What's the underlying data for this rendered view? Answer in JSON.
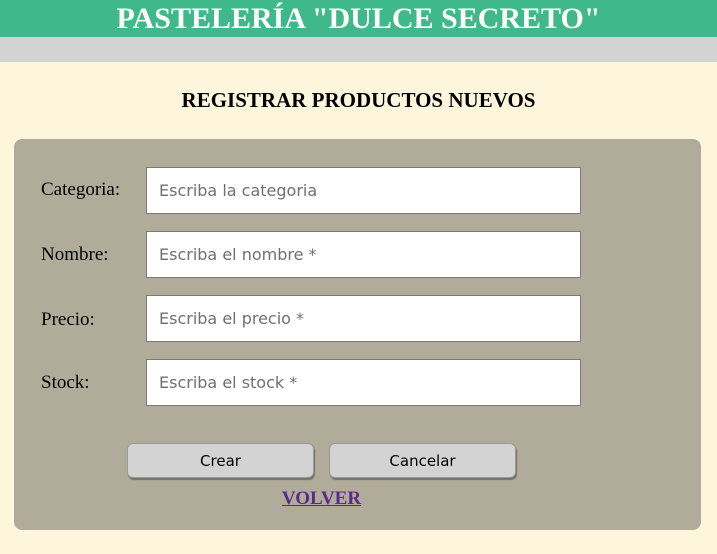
{
  "header": {
    "title": "PASTELERÍA \"DULCE SECRETO\""
  },
  "page": {
    "heading": "REGISTRAR PRODUCTOS NUEVOS"
  },
  "form": {
    "fields": [
      {
        "label": "Categoria:",
        "placeholder": "Escriba la categoria",
        "value": ""
      },
      {
        "label": "Nombre:",
        "placeholder": "Escriba el nombre *",
        "value": ""
      },
      {
        "label": "Precio:",
        "placeholder": "Escriba el precio *",
        "value": ""
      },
      {
        "label": "Stock:",
        "placeholder": "Escriba el stock *",
        "value": ""
      }
    ],
    "create_label": "Crear",
    "cancel_label": "Cancelar",
    "back_link": "VOLVER"
  },
  "colors": {
    "banner": "#3fb98b",
    "background": "#fef6dc",
    "panel": "#b1ac9a",
    "link": "#5a2a8a"
  }
}
